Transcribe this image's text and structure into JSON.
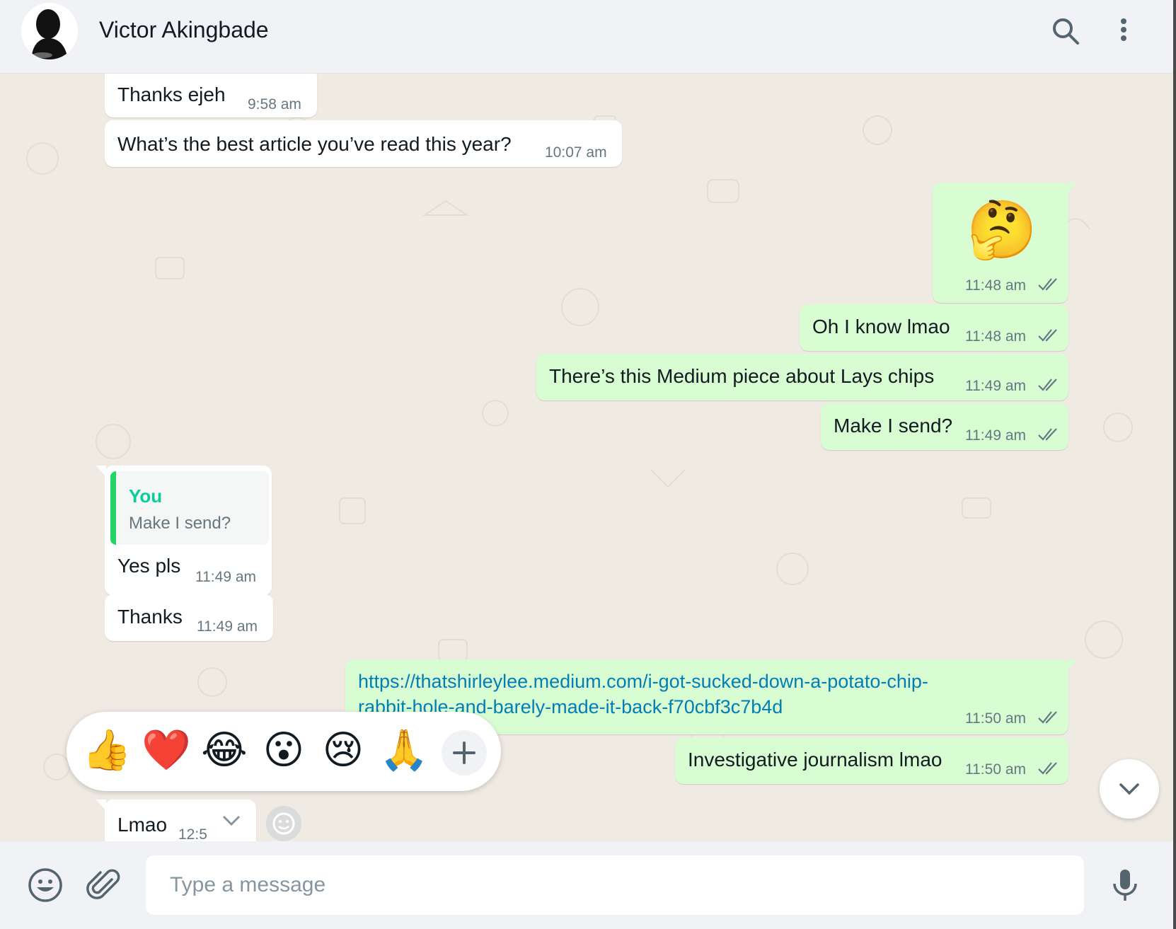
{
  "header": {
    "contact_name": "Victor Akingbade",
    "icons": [
      "search-icon",
      "menu-dots-icon"
    ]
  },
  "messages": [
    {
      "direction": "in",
      "text": "Thanks ejeh",
      "time": "9:58 am"
    },
    {
      "direction": "in",
      "text": "What’s the best article you’ve read this year?",
      "time": "10:07 am"
    },
    {
      "direction": "out",
      "text": "🤔",
      "time": "11:48 am",
      "status": "read"
    },
    {
      "direction": "out",
      "text": "Oh I know lmao",
      "time": "11:48 am",
      "status": "read"
    },
    {
      "direction": "out",
      "text": "There’s this Medium piece about Lays chips",
      "time": "11:49 am",
      "status": "read"
    },
    {
      "direction": "out",
      "text": "Make I send?",
      "time": "11:49 am",
      "status": "read"
    },
    {
      "direction": "in",
      "quote_author": "You",
      "quote_text": "Make I send?",
      "text": "Yes pls",
      "time": "11:49 am"
    },
    {
      "direction": "in",
      "text": "Thanks",
      "time": "11:49 am"
    },
    {
      "direction": "out",
      "link_line1": "https://thatshirleylee.medium.com/i-got-sucked-down-a-potato-chip-",
      "link_line2": "rabbit-hole-and-barely-made-it-back-f70cbf3c7b4d",
      "time": "11:50 am",
      "status": "read"
    },
    {
      "direction": "out",
      "text": "Investigative journalism lmao",
      "time": "11:50 am",
      "status": "read"
    },
    {
      "direction": "in",
      "text": "Lmao",
      "time": "12:5"
    }
  ],
  "reactions": [
    "👍",
    "❤️",
    "😂",
    "😮",
    "😢",
    "🙏"
  ],
  "reaction_more_icon": "plus-icon",
  "footer": {
    "placeholder": "Type a message",
    "icons": [
      "emoji-icon",
      "attach-icon",
      "microphone-icon"
    ]
  },
  "colors": {
    "header_bg": "#f0f2f5",
    "chat_bg": "#efeae2",
    "outgoing_bubble": "#d9fdd3",
    "incoming_bubble": "#ffffff",
    "quote_accent": "#25d366",
    "link": "#027eb5",
    "read_ticks": "#667781"
  }
}
